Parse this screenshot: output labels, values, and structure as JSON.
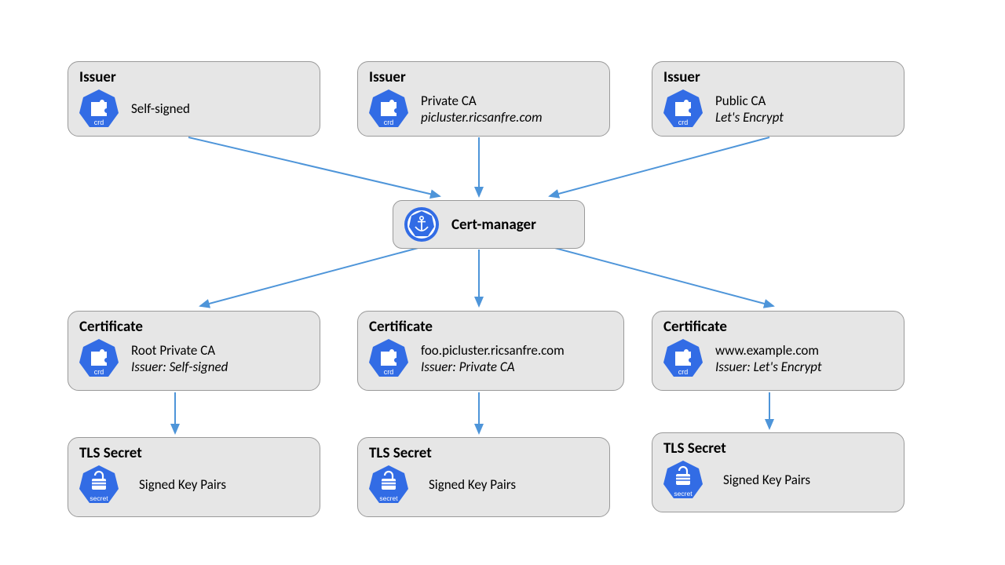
{
  "issuers": [
    {
      "title": "Issuer",
      "line1": "Self-signed",
      "line2": ""
    },
    {
      "title": "Issuer",
      "line1": "Private CA",
      "line2": "picluster.ricsanfre.com"
    },
    {
      "title": "Issuer",
      "line1": "Public CA",
      "line2": "Let's Encrypt"
    }
  ],
  "cert_manager": {
    "label": "Cert-manager"
  },
  "certificates": [
    {
      "title": "Certificate",
      "line1": "Root Private CA",
      "line2": "Issuer: Self-signed"
    },
    {
      "title": "Certificate",
      "line1": "foo.picluster.ricsanfre.com",
      "line2": "Issuer: Private CA"
    },
    {
      "title": "Certificate",
      "line1": "www.example.com",
      "line2": "Issuer: Let's Encrypt"
    }
  ],
  "secrets": [
    {
      "title": "TLS Secret",
      "line1": "Signed Key Pairs"
    },
    {
      "title": "TLS Secret",
      "line1": "Signed Key Pairs"
    },
    {
      "title": "TLS Secret",
      "line1": "Signed Key Pairs"
    }
  ],
  "icon_labels": {
    "crd": "crd",
    "secret": "secret"
  },
  "colors": {
    "kube_blue": "#326ce5",
    "arrow": "#4e95d9",
    "box_bg": "#e6e6e6"
  }
}
